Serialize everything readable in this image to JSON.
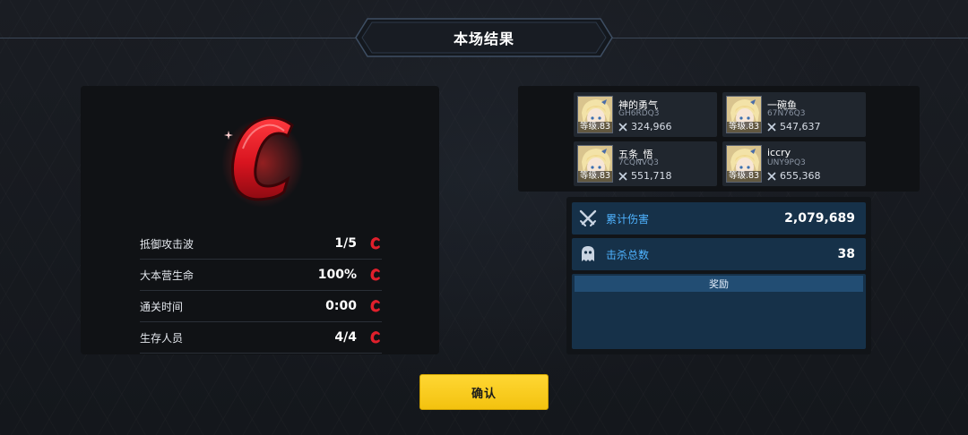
{
  "title": "本场结果",
  "grade": {
    "letter": "C",
    "color": "#e0202c"
  },
  "stats": [
    {
      "label": "抵御攻击波",
      "value": "1/5",
      "grade": "C"
    },
    {
      "label": "大本营生命",
      "value": "100%",
      "grade": "C"
    },
    {
      "label": "通关时间",
      "value": "0:00",
      "grade": "C"
    },
    {
      "label": "生存人员",
      "value": "4/4",
      "grade": "C"
    }
  ],
  "players": [
    {
      "name": "神的勇气",
      "id": "GH6RDQ3",
      "damage": "324,966",
      "level": "等级.83"
    },
    {
      "name": "一碗鱼",
      "id": "67N76Q3",
      "damage": "547,637",
      "level": "等级.83"
    },
    {
      "name": "五条_悟",
      "id": "7CQNVQ3",
      "damage": "551,718",
      "level": "等级.83"
    },
    {
      "name": "iccry",
      "id": "UNY9PQ3",
      "damage": "655,368",
      "level": "等级.83"
    }
  ],
  "summary": {
    "damage": {
      "label": "累计伤害",
      "value": "2,079,689",
      "icon": "crossed-swords-icon"
    },
    "kills": {
      "label": "击杀总数",
      "value": "38",
      "icon": "ghost-icon"
    }
  },
  "reward": {
    "label": "奖励"
  },
  "confirm": {
    "label": "确认"
  },
  "colors": {
    "accent_blue": "#4fb3ff",
    "confirm_yellow": "#f5c518",
    "grade_red": "#e0202c"
  }
}
